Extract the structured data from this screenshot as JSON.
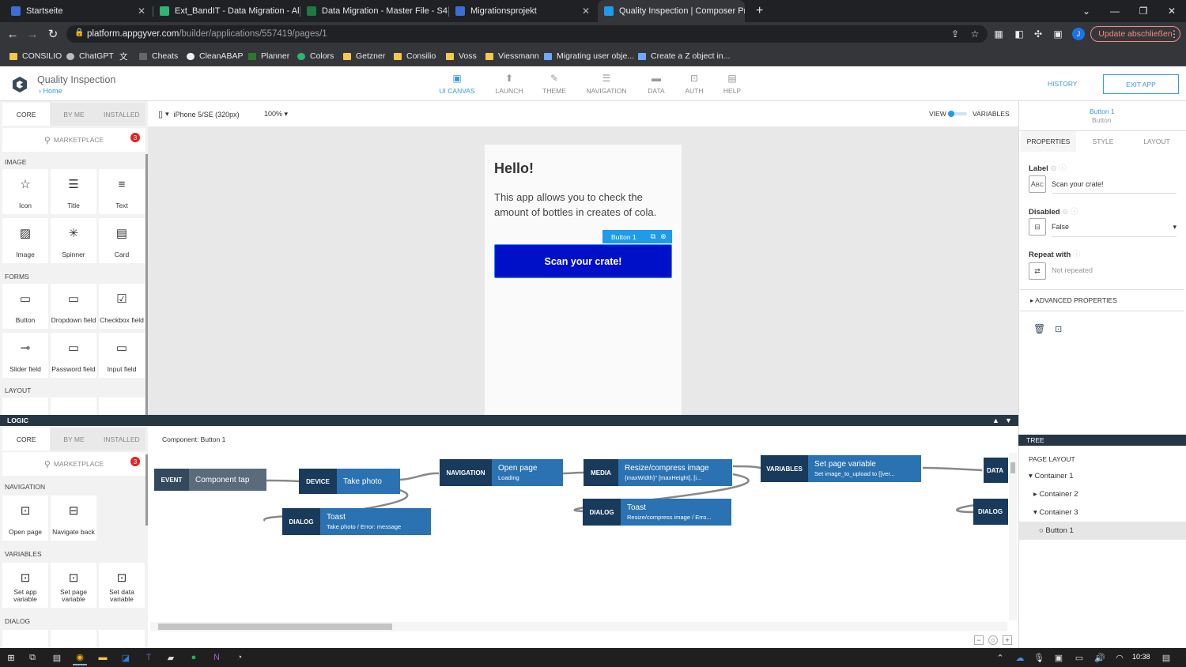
{
  "browser": {
    "tabs": [
      {
        "title": "Startseite",
        "favicon_color": "#3b6fd6"
      },
      {
        "title": "Ext_BandIT - Data Migration - All",
        "favicon_color": "#2bb673"
      },
      {
        "title": "Data Migration - Master File - S4",
        "favicon_color": "#1d7a45"
      },
      {
        "title": "Migrationsprojekt",
        "favicon_color": "#3b6fd6"
      },
      {
        "title": "Quality Inspection | Composer Pr",
        "favicon_color": "#1e9be9"
      }
    ],
    "new_tab": "+",
    "url_host": "platform.appgyver.com",
    "url_path": "/builder/applications/557419/pages/1",
    "update_label": "Update abschließen",
    "profile_initial": "J",
    "bookmarks": [
      "CONSILIO",
      "ChatGPT",
      "",
      "Cheats",
      "CleanABAP",
      "Planner",
      "Colors",
      "Getzner",
      "Consilio",
      "Voss",
      "Viessmann",
      "Migrating user obje...",
      "Create a Z object in..."
    ]
  },
  "app": {
    "title": "Quality Inspection",
    "breadcrumb": "Home",
    "nav": [
      {
        "label": "UI CANVAS",
        "icon": "canvas-icon",
        "selected": true
      },
      {
        "label": "LAUNCH",
        "icon": "launch-icon"
      },
      {
        "label": "THEME",
        "icon": "theme-icon"
      },
      {
        "label": "NAVIGATION",
        "icon": "navigation-icon"
      },
      {
        "label": "DATA",
        "icon": "data-icon"
      },
      {
        "label": "AUTH",
        "icon": "auth-icon"
      },
      {
        "label": "HELP",
        "icon": "help-icon"
      }
    ],
    "history": "HISTORY",
    "exit": "EXIT APP"
  },
  "palette": {
    "tabs": [
      "CORE",
      "BY ME",
      "INSTALLED"
    ],
    "search_placeholder": "MARKETPLACE",
    "badge": "3",
    "sections": {
      "image": "IMAGE",
      "forms": "FORMS",
      "layout": "LAYOUT"
    },
    "image_items": [
      "Icon",
      "Title",
      "Text",
      "Image",
      "Spinner",
      "Card"
    ],
    "form_items": [
      "Button",
      "Dropdown field",
      "Checkbox field",
      "Slider field",
      "Password field",
      "Input field"
    ]
  },
  "canvas": {
    "device": "iPhone 5/SE (320px)",
    "zoom": "100%",
    "view_label": "VIEW",
    "variables_label": "VARIABLES",
    "heading": "Hello!",
    "description": "This app allows you to check the amount of bottles in creates of cola.",
    "selected_tag": "Button 1",
    "button_label": "Scan your crate!"
  },
  "properties": {
    "selected_name": "Button 1",
    "selected_type": "Button",
    "tabs": [
      "PROPERTIES",
      "STYLE",
      "LAYOUT"
    ],
    "label_title": "Label",
    "label_value": "Scan your crate!",
    "disabled_title": "Disabled",
    "disabled_value": "False",
    "repeat_title": "Repeat with",
    "repeat_value": "Not repeated",
    "advanced": "ADVANCED PROPERTIES"
  },
  "logic": {
    "title": "LOGIC",
    "component": "Component: Button 1",
    "tabs": [
      "CORE",
      "BY ME",
      "INSTALLED"
    ],
    "search_placeholder": "MARKETPLACE",
    "badge": "3",
    "navigation_section": "NAVIGATION",
    "navigation_items": [
      "Open page",
      "Navigate back"
    ],
    "variables_section": "VARIABLES",
    "variables_items": [
      "Set app variable",
      "Set page variable",
      "Set data variable"
    ],
    "dialog_section": "DIALOG",
    "nodes": [
      {
        "tag": "EVENT",
        "title": "Component tap",
        "sub": ""
      },
      {
        "tag": "DEVICE",
        "title": "Take photo",
        "sub": ""
      },
      {
        "tag": "DIALOG",
        "title": "Toast",
        "sub": "Take photo / Error: message"
      },
      {
        "tag": "NAVIGATION",
        "title": "Open page",
        "sub": "Loading"
      },
      {
        "tag": "MEDIA",
        "title": "Resize/compress image",
        "sub": "{maxWidth}\" [maxHeight], [i..."
      },
      {
        "tag": "DIALOG",
        "title": "Toast",
        "sub": "Resize/compress image / Erro..."
      },
      {
        "tag": "VARIABLES",
        "title": "Set page variable",
        "sub": "Set image_to_upload to [[ver..."
      },
      {
        "tag": "DATA",
        "title": "",
        "sub": ""
      },
      {
        "tag": "DIALOG",
        "title": "",
        "sub": ""
      }
    ]
  },
  "tree": {
    "title": "TREE",
    "root": "PAGE LAYOUT",
    "items": [
      "Container 1",
      "Container 2",
      "Container 3",
      "Button 1"
    ]
  },
  "taskbar": {
    "time": "10:38"
  }
}
